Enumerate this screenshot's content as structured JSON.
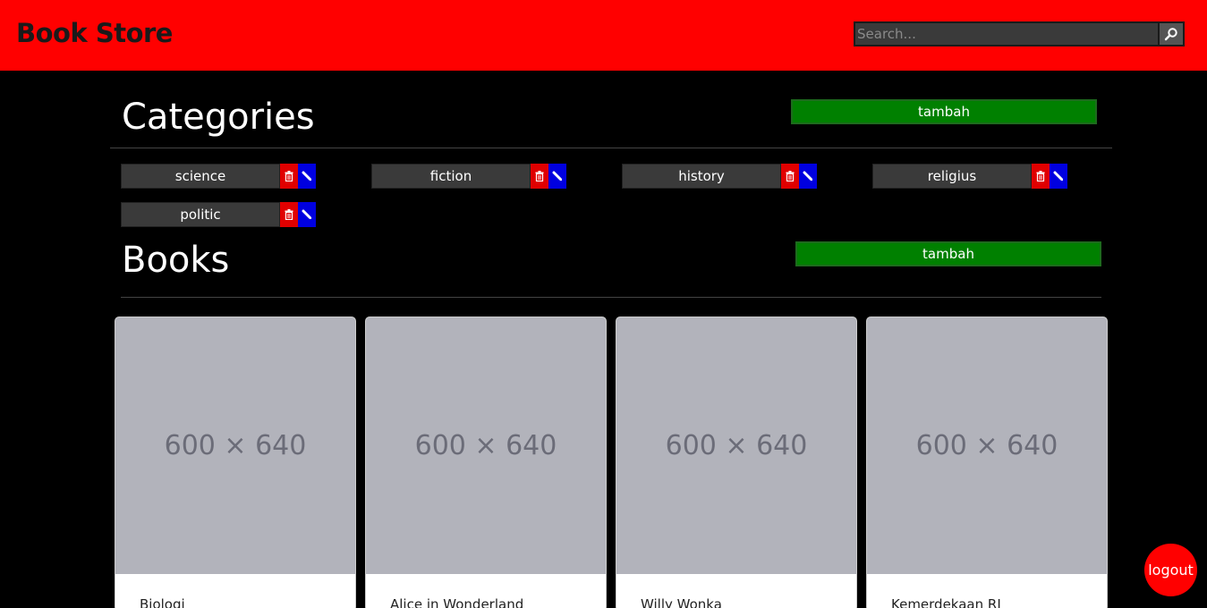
{
  "header": {
    "brand": "Book Store",
    "search_placeholder": "Search..."
  },
  "categories": {
    "title": "Categories",
    "add_label": "tambah",
    "items": [
      {
        "label": "science"
      },
      {
        "label": "fiction"
      },
      {
        "label": "history"
      },
      {
        "label": "religius"
      },
      {
        "label": "politic"
      }
    ]
  },
  "books": {
    "title": "Books",
    "add_label": "tambah",
    "items": [
      {
        "image_text": "600 × 640",
        "title": "Biologi"
      },
      {
        "image_text": "600 × 640",
        "title": "Alice in Wonderland"
      },
      {
        "image_text": "600 × 640",
        "title": "Willy Wonka"
      },
      {
        "image_text": "600 × 640",
        "title": "Kemerdekaan RI"
      }
    ]
  },
  "logout_label": "logout",
  "colors": {
    "header_bg": "#ff0000",
    "add_button": "#008000",
    "delete_button": "#e00000",
    "edit_button": "#0000e0"
  },
  "icons": {
    "search": "search-icon",
    "delete": "trash-icon",
    "edit": "pencil-icon"
  }
}
